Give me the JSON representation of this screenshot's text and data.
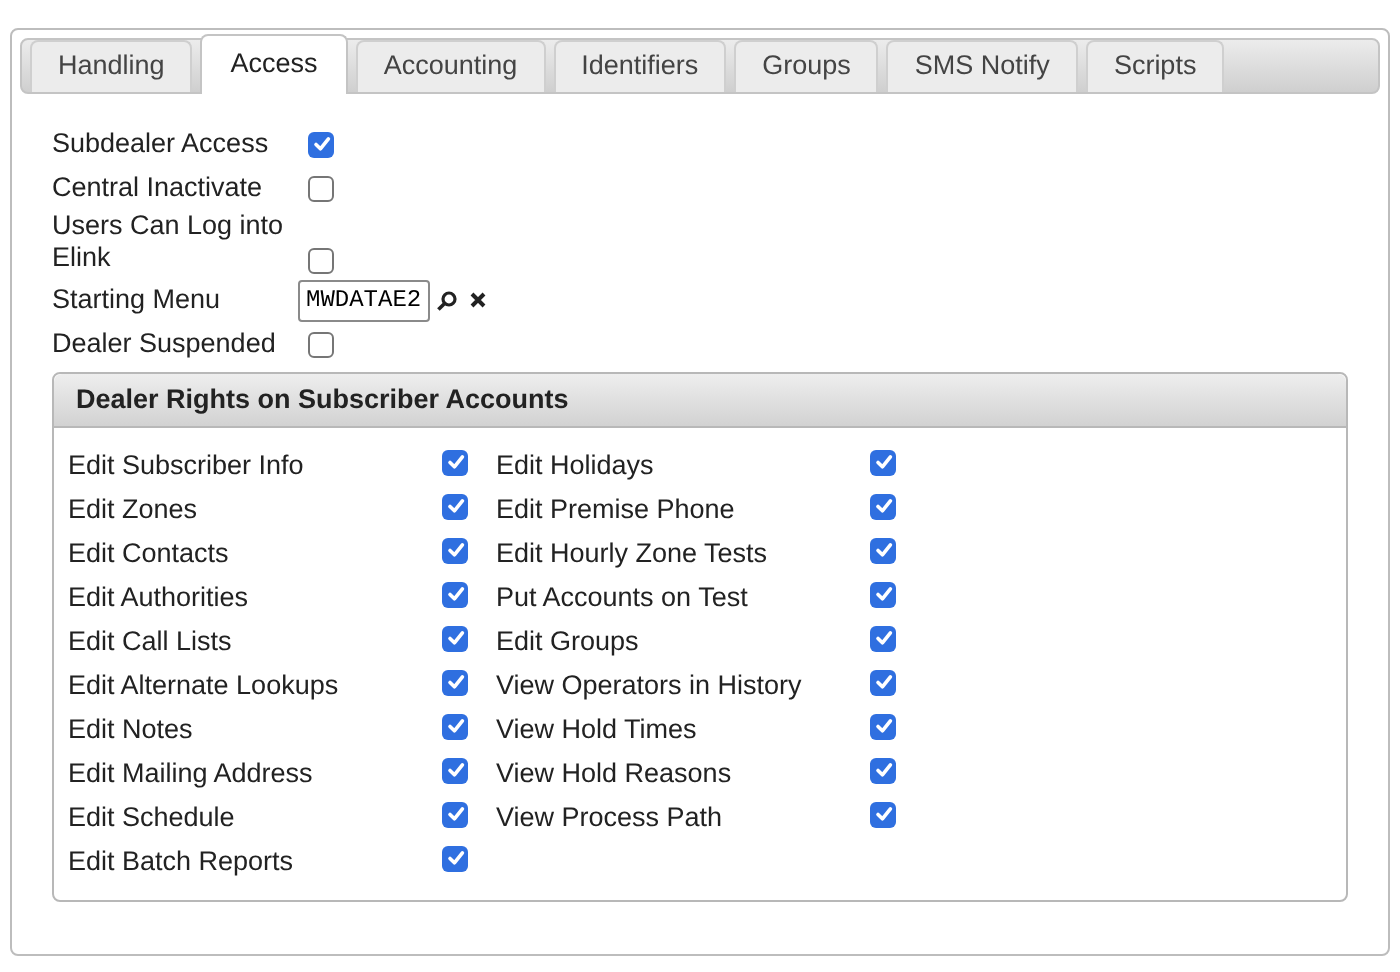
{
  "tabs": [
    {
      "label": "Handling",
      "selected": false
    },
    {
      "label": "Access",
      "selected": true
    },
    {
      "label": "Accounting",
      "selected": false
    },
    {
      "label": "Identifiers",
      "selected": false
    },
    {
      "label": "Groups",
      "selected": false
    },
    {
      "label": "SMS Notify",
      "selected": false
    },
    {
      "label": "Scripts",
      "selected": false
    }
  ],
  "settings": [
    {
      "kind": "checkbox",
      "label": "Subdealer Access",
      "checked": true
    },
    {
      "kind": "checkbox",
      "label": "Central Inactivate",
      "checked": false
    },
    {
      "kind": "checkbox",
      "label": "Users Can Log into Elink",
      "checked": false
    },
    {
      "kind": "lookup",
      "label": "Starting Menu",
      "value": "MWDATAE2"
    },
    {
      "kind": "checkbox",
      "label": "Dealer Suspended",
      "checked": false
    }
  ],
  "dealer_rights": {
    "title": "Dealer Rights on Subscriber Accounts",
    "columns": [
      [
        {
          "label": "Edit Subscriber Info",
          "checked": true
        },
        {
          "label": "Edit Zones",
          "checked": true
        },
        {
          "label": "Edit Contacts",
          "checked": true
        },
        {
          "label": "Edit Authorities",
          "checked": true
        },
        {
          "label": "Edit Call Lists",
          "checked": true
        },
        {
          "label": "Edit Alternate Lookups",
          "checked": true
        },
        {
          "label": "Edit Notes",
          "checked": true
        },
        {
          "label": "Edit Mailing Address",
          "checked": true
        },
        {
          "label": "Edit Schedule",
          "checked": true
        },
        {
          "label": "Edit Batch Reports",
          "checked": true
        }
      ],
      [
        {
          "label": "Edit Holidays",
          "checked": true
        },
        {
          "label": "Edit Premise Phone",
          "checked": true
        },
        {
          "label": "Edit Hourly Zone Tests",
          "checked": true
        },
        {
          "label": "Put Accounts on Test",
          "checked": true
        },
        {
          "label": "Edit Groups",
          "checked": true
        },
        {
          "label": "View Operators in History",
          "checked": true
        },
        {
          "label": "View Hold Times",
          "checked": true
        },
        {
          "label": "View Hold Reasons",
          "checked": true
        },
        {
          "label": "View Process Path",
          "checked": true
        }
      ]
    ]
  }
}
